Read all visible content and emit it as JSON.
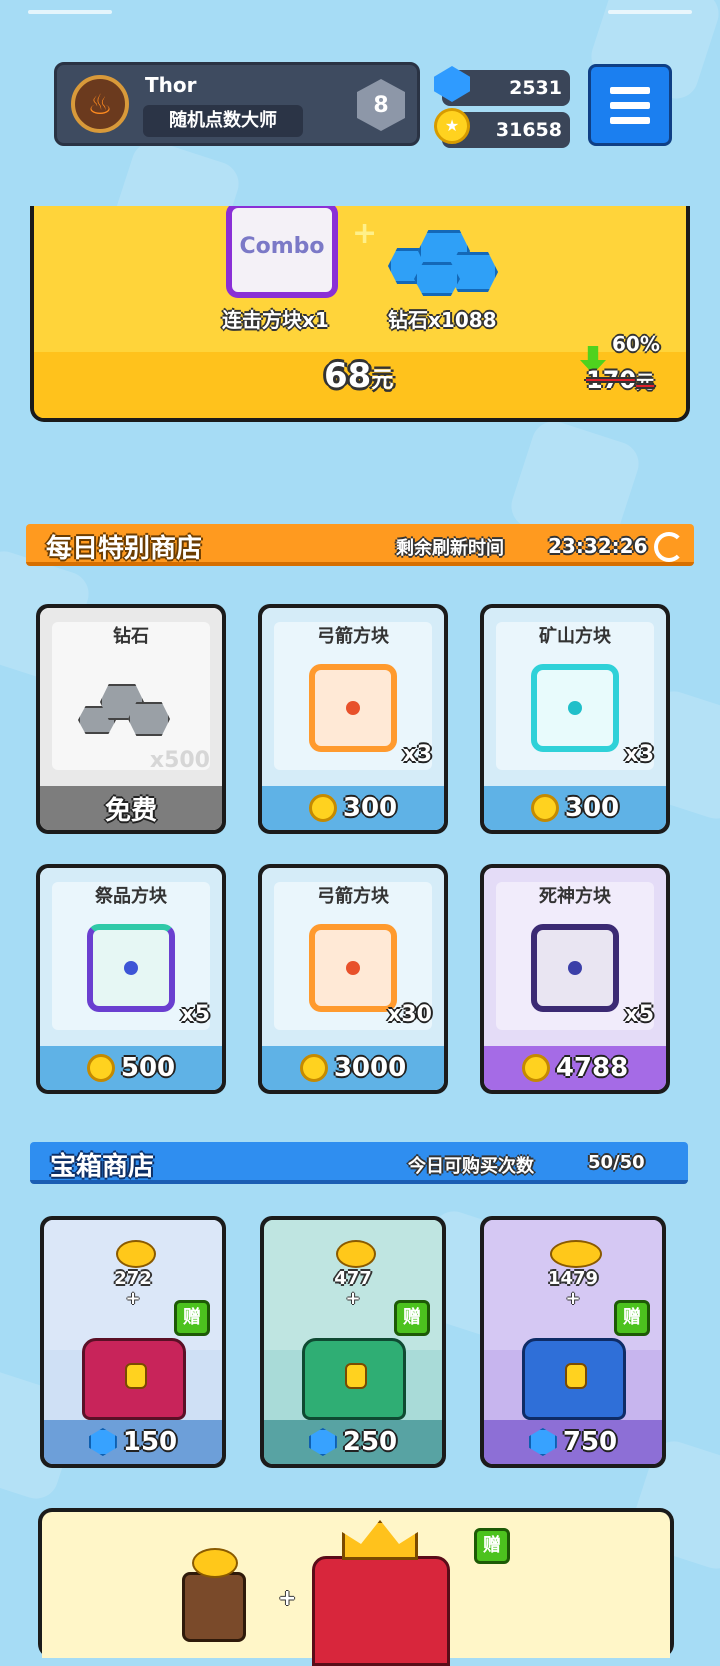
{
  "player": {
    "name": "Thor",
    "title": "随机点数大师",
    "rank": "8"
  },
  "currency": {
    "gems": "2531",
    "coins": "31658"
  },
  "banner": {
    "item1_logo": "Combo",
    "item1_label": "连击方块x1",
    "item2_label": "钻石x1088",
    "price_value": "68",
    "price_unit": "元",
    "discount": "60%",
    "original_value": "170",
    "original_unit": "元"
  },
  "daily_shop": {
    "title": "每日特别商店",
    "refresh_label": "剩余刷新时间",
    "refresh_time": "23:32:26",
    "items": [
      {
        "name": "钻石",
        "qty": "x500",
        "price": "免费",
        "icon": "diamond-rocks-icon"
      },
      {
        "name": "弓箭方块",
        "qty": "x3",
        "price": "300",
        "icon": "bow-dice-icon"
      },
      {
        "name": "矿山方块",
        "qty": "x3",
        "price": "300",
        "icon": "mine-dice-icon"
      },
      {
        "name": "祭品方块",
        "qty": "x5",
        "price": "500",
        "icon": "sacrifice-dice-icon"
      },
      {
        "name": "弓箭方块",
        "qty": "x30",
        "price": "3000",
        "icon": "bow-dice-icon"
      },
      {
        "name": "死神方块",
        "qty": "x5",
        "price": "4788",
        "icon": "reaper-dice-icon"
      }
    ]
  },
  "chest_shop": {
    "title": "宝箱商店",
    "limit_label": "今日可购买次数",
    "limit_value": "50/50",
    "gift_badge": "赠",
    "chests": [
      {
        "coins": "272",
        "plus": "+",
        "price": "150"
      },
      {
        "coins": "477",
        "plus": "+",
        "price": "250"
      },
      {
        "coins": "1479",
        "plus": "+",
        "price": "750"
      }
    ]
  },
  "bundle": {
    "gift_badge": "赠",
    "plus": "+"
  },
  "colors": {
    "bg": "#a6dcf5",
    "orange_header": "#ff9a1f",
    "blue_header": "#2f8ef0",
    "banner_yellow": "#ffd43a",
    "purple_accent": "#a56be6"
  }
}
